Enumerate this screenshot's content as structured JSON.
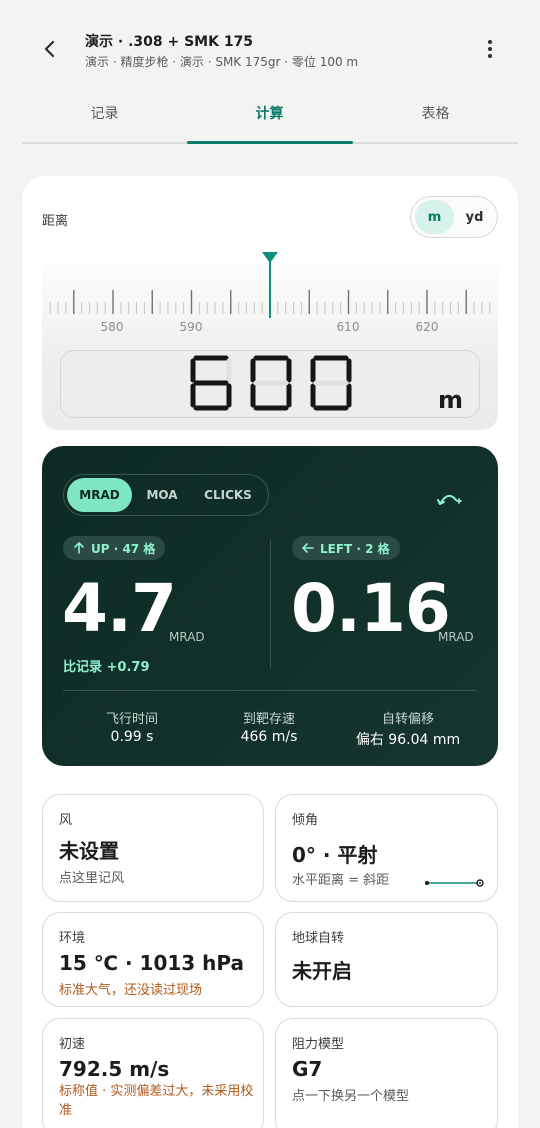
{
  "header": {
    "title": "演示 · .308 + SMK 175",
    "subtitle": "演示 · 精度步枪 · 演示 · SMK 175gr · 零位 100 m"
  },
  "tabs": [
    {
      "label": "记录"
    },
    {
      "label": "计算"
    },
    {
      "label": "表格"
    }
  ],
  "distance": {
    "label": "距离",
    "units": [
      "m",
      "yd"
    ],
    "selected_unit": "m",
    "ruler_labels": [
      "580",
      "590",
      "610",
      "620"
    ],
    "value": "600",
    "unit_label": "m"
  },
  "solution": {
    "modes": [
      "MRAD",
      "MOA",
      "CLICKS"
    ],
    "selected_mode": "MRAD",
    "elevation": {
      "chip": "UP · 47 格",
      "value": "4.7",
      "unit": "MRAD",
      "delta": "比记录 +0.79"
    },
    "windage": {
      "chip": "LEFT · 2 格",
      "value": "0.16",
      "unit": "MRAD"
    },
    "stats": [
      {
        "label": "飞行时间",
        "value": "0.99 s"
      },
      {
        "label": "到靶存速",
        "value": "466 m/s"
      },
      {
        "label": "自转偏移",
        "value": "偏右 96.04 mm"
      }
    ]
  },
  "cards": {
    "wind": {
      "label": "风",
      "value": "未设置",
      "sub": "点这里记风"
    },
    "angle": {
      "label": "倾角",
      "value": "0° · 平射",
      "sub": "水平距离 = 斜距"
    },
    "env": {
      "label": "环境",
      "value": "15 ℃ · 1013 hPa",
      "sub": "标准大气，还没读过现场"
    },
    "coriolis": {
      "label": "地球自转",
      "value": "未开启"
    },
    "mv": {
      "label": "初速",
      "value": "792.5 m/s",
      "sub": "标称值 · 实测偏差过大，未采用校准"
    },
    "drag": {
      "label": "阻力模型",
      "value": "G7",
      "sub": "点一下换另一个模型"
    }
  },
  "colors": {
    "accent": "#0c7a68",
    "dark_card": "#0d2b24",
    "mint": "#7fe6c4",
    "warning": "#b05a1a"
  }
}
